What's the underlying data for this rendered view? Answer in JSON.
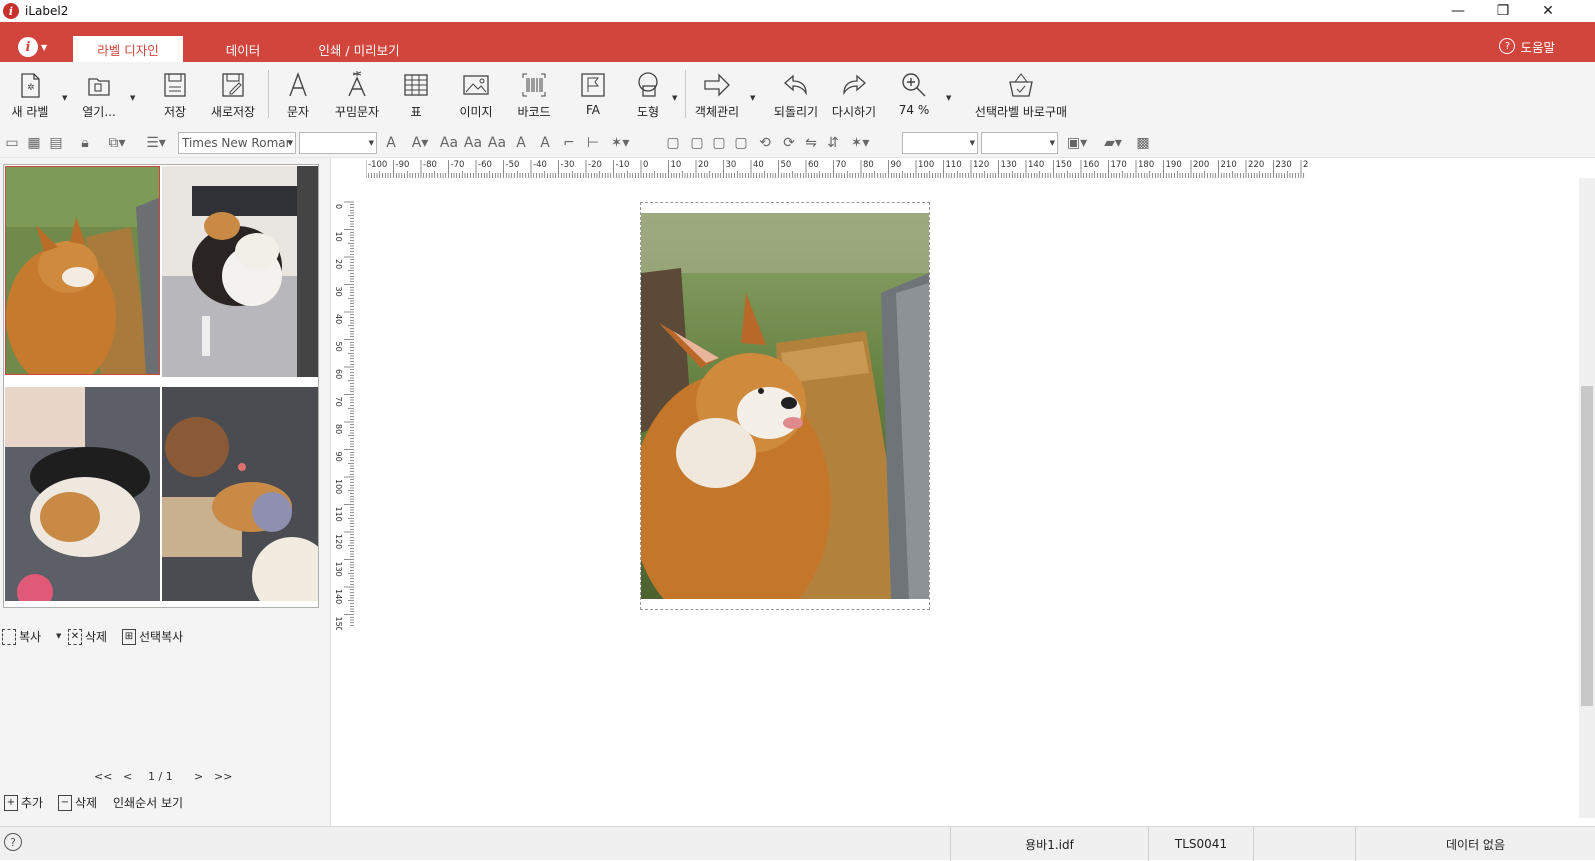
{
  "window": {
    "title": "iLabel2",
    "minimize_glyph": "—",
    "restore_glyph": "❐",
    "close_glyph": "✕"
  },
  "ribbon": {
    "tabs": [
      {
        "label": "라벨 디자인",
        "active": true
      },
      {
        "label": "데이터",
        "active": false
      },
      {
        "label": "인쇄 / 미리보기",
        "active": false
      }
    ],
    "help_label": "도움말",
    "accent_color": "#d2453d"
  },
  "toolbar": {
    "new_label": "새 라벨",
    "open": "열기...",
    "save": "저장",
    "save_as": "새로저장",
    "text": "문자",
    "decor_text": "꾸밈문자",
    "table": "표",
    "image": "이미지",
    "barcode": "바코드",
    "fa": "FA",
    "shape": "도형",
    "object_mgmt": "객체관리",
    "undo": "되돌리기",
    "redo": "다시하기",
    "zoom": "74 %",
    "buy": "선택라벨 바로구매"
  },
  "format": {
    "font_name": "Times New Romar",
    "font_size": ""
  },
  "left_panel": {
    "copy": "복사",
    "delete": "삭제",
    "select_copy": "선택복사",
    "nav_first": "<<",
    "nav_prev": "<",
    "page_indicator": "1 / 1",
    "nav_next": ">",
    "nav_last": ">>",
    "add": "추가",
    "delete_page": "삭제",
    "print_order": "인쇄순서 보기"
  },
  "ruler": {
    "h_ticks": [
      "-100",
      "-90",
      "-80",
      "-70",
      "-60",
      "-50",
      "-40",
      "-30",
      "-20",
      "-10",
      "0",
      "10",
      "20",
      "30",
      "40",
      "50",
      "60",
      "70",
      "80",
      "90",
      "100",
      "110",
      "120",
      "130",
      "140",
      "150",
      "160",
      "170",
      "180",
      "190",
      "200",
      "210",
      "220",
      "230",
      "2"
    ],
    "v_ticks": [
      "0",
      "10",
      "20",
      "30",
      "40",
      "50",
      "60",
      "70",
      "80",
      "90",
      "100",
      "110",
      "120",
      "130",
      "140",
      "150"
    ]
  },
  "status": {
    "file": "용바1.idf",
    "code": "TLS0041",
    "data": "데이터 없음"
  }
}
